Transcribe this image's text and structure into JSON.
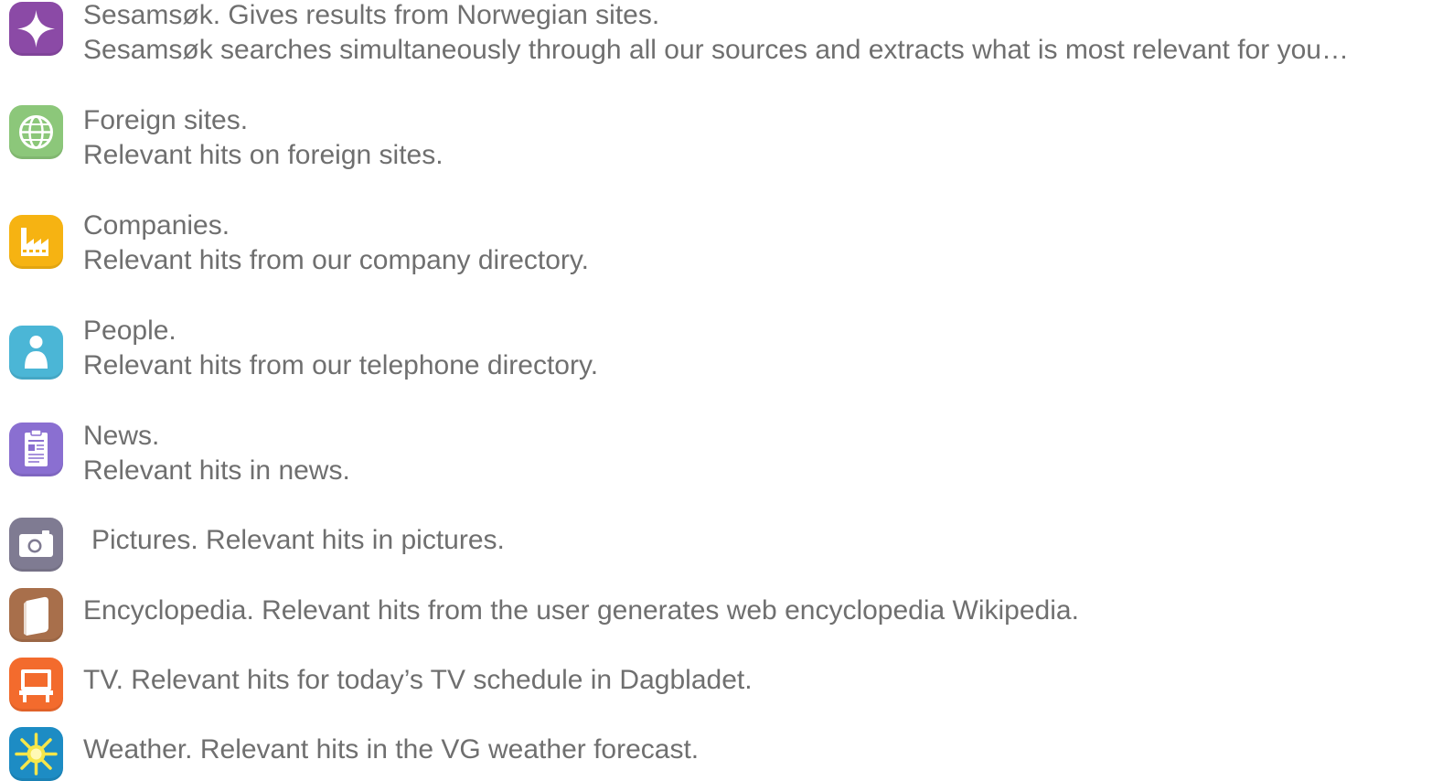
{
  "items": [
    {
      "icon": "sparkle-star-icon",
      "color": "#8b4aa6",
      "title": "Sesamsøk. Gives results from Norwegian sites.",
      "desc": "Sesamsøk searches simultaneously through all our sources and extracts what is most relevant for you…"
    },
    {
      "icon": "globe-icon",
      "color": "#8cc77a",
      "title": "Foreign sites.",
      "desc": "Relevant hits on foreign sites."
    },
    {
      "icon": "factory-icon",
      "color": "#f6b312",
      "title": "Companies.",
      "desc": "Relevant hits from our company directory."
    },
    {
      "icon": "person-icon",
      "color": "#4bb6d6",
      "title": "People.",
      "desc": "Relevant hits from our telephone directory."
    },
    {
      "icon": "newspaper-clipboard-icon",
      "color": "#8a6fd1",
      "title": "News.",
      "desc": "Relevant hits in news."
    },
    {
      "icon": "camera-icon",
      "color": "#7f7b92",
      "text": "Pictures. Relevant hits in pictures."
    },
    {
      "icon": "book-icon",
      "color": "#a86f4b",
      "text": "Encyclopedia. Relevant hits from the user generates web encyclopedia Wikipedia."
    },
    {
      "icon": "tv-icon",
      "color": "#f36b2d",
      "text": "TV. Relevant hits for today’s TV schedule in Dagbladet."
    },
    {
      "icon": "sun-icon",
      "color": "#1d8cc4",
      "text": "Weather. Relevant hits in the VG weather forecast."
    }
  ]
}
